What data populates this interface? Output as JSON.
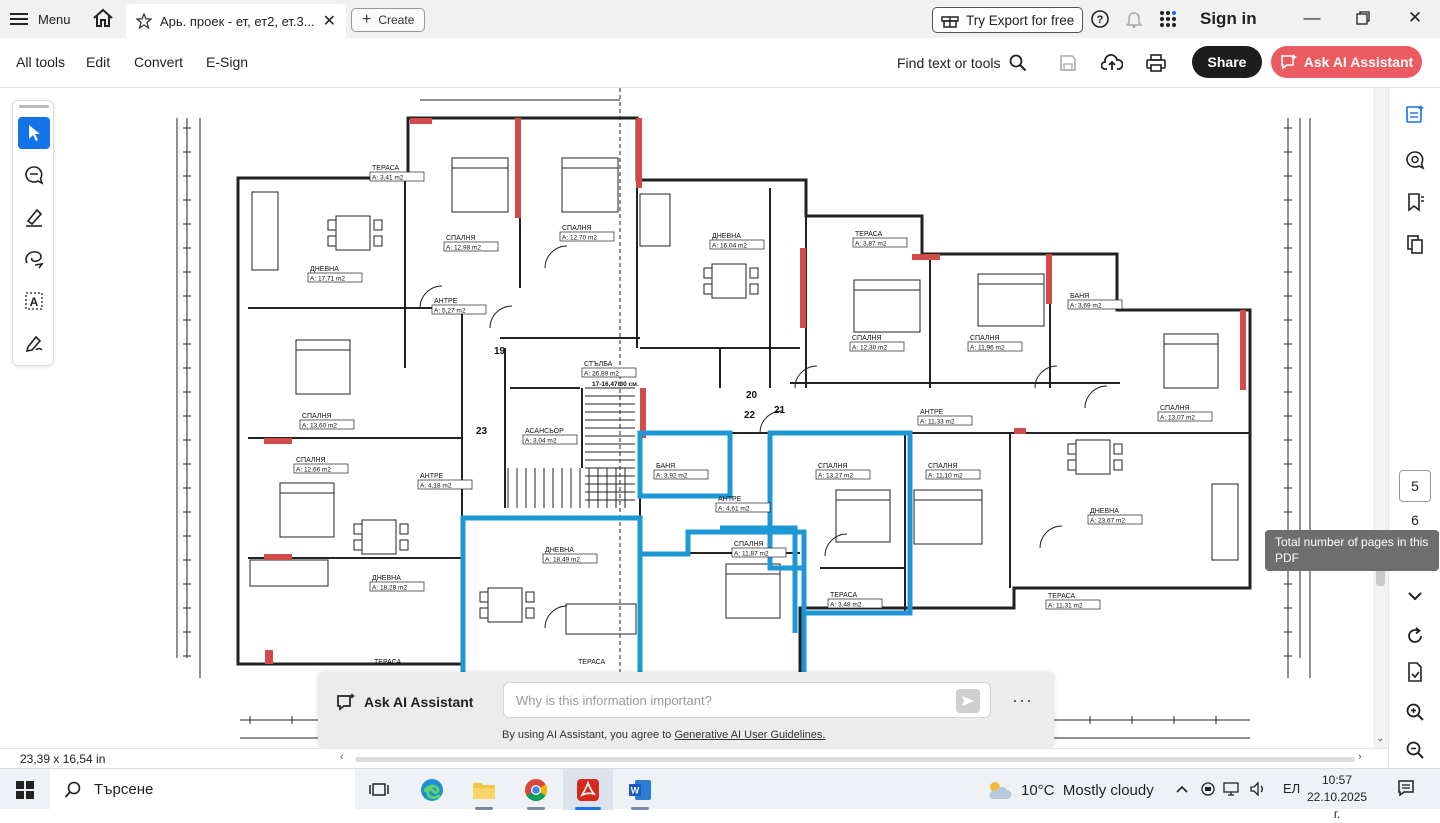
{
  "titlebar": {
    "menu_label": "Menu",
    "tab_title": "Арь. проек - ет, ет2, ет.3...",
    "create_label": "Create",
    "export_label": "Try Export for free",
    "signin_label": "Sign in"
  },
  "toolbar": {
    "items": [
      "All tools",
      "Edit",
      "Convert",
      "E-Sign"
    ],
    "find_label": "Find text or tools",
    "share_label": "Share",
    "ai_label": "Ask AI Assistant"
  },
  "colors": {
    "accent_blue": "#1473e6",
    "ai_button": "#ec5a62",
    "highlight_blue": "#1c98d6",
    "wall_red": "#d14b4b"
  },
  "drawing": {
    "rooms": [
      {
        "name": "ТЕРАСА",
        "area": "A: 3,41 m2"
      },
      {
        "name": "ДНЕВНА",
        "area": "A: 17,71 m2"
      },
      {
        "name": "СПАЛНЯ",
        "area": "A: 12,98 m2"
      },
      {
        "name": "СПАЛНЯ",
        "area": "A: 12,70 m2"
      },
      {
        "name": "ДНЕВНА",
        "area": "A: 16,04 m2"
      },
      {
        "name": "ТЕРАСА",
        "area": "A: 3,87 m2"
      },
      {
        "name": "АНТРЕ",
        "area": "A: 5,27 m2"
      },
      {
        "name": "СПАЛНЯ",
        "area": "A: 13,60 m2"
      },
      {
        "name": "СТЪЛБА",
        "area": "A: 26,89 m2"
      },
      {
        "name": "СПАЛНЯ",
        "area": "A: 12,30 m2"
      },
      {
        "name": "СПАЛНЯ",
        "area": "A: 11,96 m2"
      },
      {
        "name": "БАНЯ",
        "area": "A: 3,69 m2"
      },
      {
        "name": "АСАНСЬОР",
        "area": "A: 3,04 m2"
      },
      {
        "name": "АНТРЕ",
        "area": "A: 11,33 m2"
      },
      {
        "name": "СПАЛНЯ",
        "area": "A: 13,07 m2"
      },
      {
        "name": "СПАЛНЯ",
        "area": "A: 12,66 m2"
      },
      {
        "name": "АНТРЕ",
        "area": "A: 4,18 m2"
      },
      {
        "name": "БАНЯ",
        "area": "A: 3,92 m2"
      },
      {
        "name": "АНТРЕ",
        "area": "A: 4,61 m2"
      },
      {
        "name": "СПАЛНЯ",
        "area": "A: 13,27 m2"
      },
      {
        "name": "СПАЛНЯ",
        "area": "A: 11,10 m2"
      },
      {
        "name": "ДНЕВНА",
        "area": "A: 23,67 m2"
      },
      {
        "name": "ДНЕВНА",
        "area": "A: 18,49 m2"
      },
      {
        "name": "СПАЛНЯ",
        "area": "A: 11,87 m2"
      },
      {
        "name": "ДНЕВНА",
        "area": "A: 18,28 m2"
      },
      {
        "name": "ТЕРАСА",
        "area": "A: 3,48 m2"
      },
      {
        "name": "ТЕРАСА",
        "area": "A: 11,31 m2"
      },
      {
        "name": "ТЕРАСА",
        "area": ""
      },
      {
        "name": "ТЕРАСА",
        "area": ""
      }
    ],
    "stair_note": "17-16,47/30 см.",
    "numbers": [
      "19",
      "20",
      "21",
      "22",
      "23"
    ]
  },
  "rightrail": {
    "current_page": "5",
    "total_pages": "6",
    "tooltip": "Total number of pages in this PDF"
  },
  "ai_panel": {
    "title": "Ask AI Assistant",
    "placeholder": "Why is this information important?",
    "legal_prefix": "By using AI Assistant, you agree to",
    "legal_link": "Generative AI User Guidelines."
  },
  "statusbar": {
    "dimensions": "23,39 x 16,54 in"
  },
  "taskbar": {
    "search_label": "Търсене",
    "weather": "10°C  Mostly cloudy",
    "lang": "ЕЛ",
    "time": "10:57",
    "date": "22.10.2025 г."
  }
}
